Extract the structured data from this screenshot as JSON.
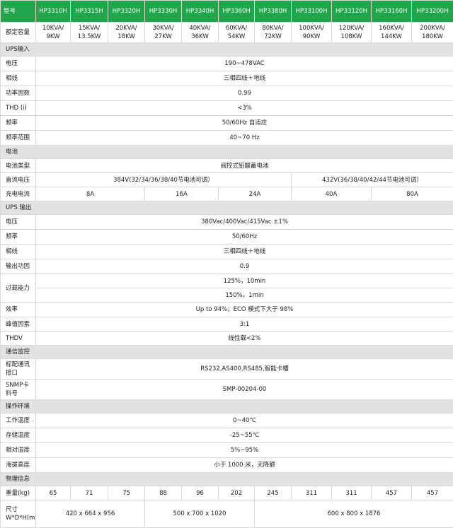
{
  "header": {
    "label": "型号",
    "models": [
      "HP3310H",
      "HP3315H",
      "HP3320H",
      "HP3330H",
      "HP3340H",
      "HP3360H",
      "HP3380H",
      "HP33100H",
      "HP33120H",
      "HP33160H",
      "HP33200H"
    ]
  },
  "rated_capacity": {
    "label": "额定容量",
    "values": [
      "10KVA/ 9KW",
      "15KVA/ 13.5KW",
      "20KVA/ 18KW",
      "30KVA/ 27KW",
      "40KVA/ 36KW",
      "60KVA/ 54KW",
      "80KVA/ 72KW",
      "100KVA/ 90KW",
      "120KVA/ 108KW",
      "160KVA/ 144KW",
      "200KVA/ 180KW"
    ]
  },
  "ups_input": {
    "title": "UPS输入",
    "rows": [
      {
        "label": "电压",
        "value": "190~478VAC"
      },
      {
        "label": "相线",
        "value": "三相四线＋地线"
      },
      {
        "label": "功率因数",
        "value": "0.99"
      },
      {
        "label": "THD (i)",
        "value": "<3%"
      },
      {
        "label": "频率",
        "value": "50/60Hz 自适应"
      },
      {
        "label": "频率范围",
        "value": "40~70 Hz"
      }
    ]
  },
  "battery": {
    "title": "电池",
    "type_label": "电池类型",
    "type_value": "阀控式铅酸蓄电池",
    "dc_label": "直流电压",
    "dc_value_a": "384V(32/34/36/38/40节电池可调）",
    "dc_value_b": "432V(36/38/40/42/44节电池可调）",
    "charge_label": "充电电流",
    "charge_values": [
      "8A",
      "16A",
      "24A",
      "40A",
      "80A"
    ]
  },
  "ups_output": {
    "title": "UPS 输出",
    "voltage_label": "电压",
    "voltage_value": "380Vac/400Vac/415Vac ±1%",
    "freq_label": "频率",
    "freq_value": "50/60Hz",
    "phase_label": "相线",
    "phase_value": "三相四线＋地线",
    "pf_label": "输出功因",
    "pf_value": "0.9",
    "overload_label": "过载能力",
    "overload_values": [
      "125%，10min",
      "150%，1min"
    ],
    "eff_label": "效率",
    "eff_value": "Up to 94%；ECO 模式下大于 98%",
    "crest_label": "峰值因素",
    "crest_value": "3:1",
    "thdv_label": "THDV",
    "thdv_value": "线性载<2%"
  },
  "comm": {
    "title": "通信监控",
    "std_label": "标配通讯接口",
    "std_value": "RS232,AS400,RS485,智能卡槽",
    "snmp_label": "SNMP卡料号",
    "snmp_value": "SMP-00204-00"
  },
  "env": {
    "title": "操作环境",
    "rows": [
      {
        "label": "工作温度",
        "value": "0~40℃"
      },
      {
        "label": "存储温度",
        "value": "-25~55℃"
      },
      {
        "label": "相对湿度",
        "value": "5%~95%"
      },
      {
        "label": "海拔高度",
        "value": "小于 1000 米，无降额"
      }
    ]
  },
  "physical": {
    "title": "物理信息",
    "weight_label": "重量(kg)",
    "weights": [
      "65",
      "71",
      "75",
      "88",
      "96",
      "202",
      "245",
      "311",
      "311",
      "457",
      "457"
    ],
    "size_label": "尺寸W*D*H(mm)",
    "sizes": [
      "420 x 664 x 956",
      "500 x 700 x 1020",
      "600 x 800 x 1876"
    ]
  }
}
